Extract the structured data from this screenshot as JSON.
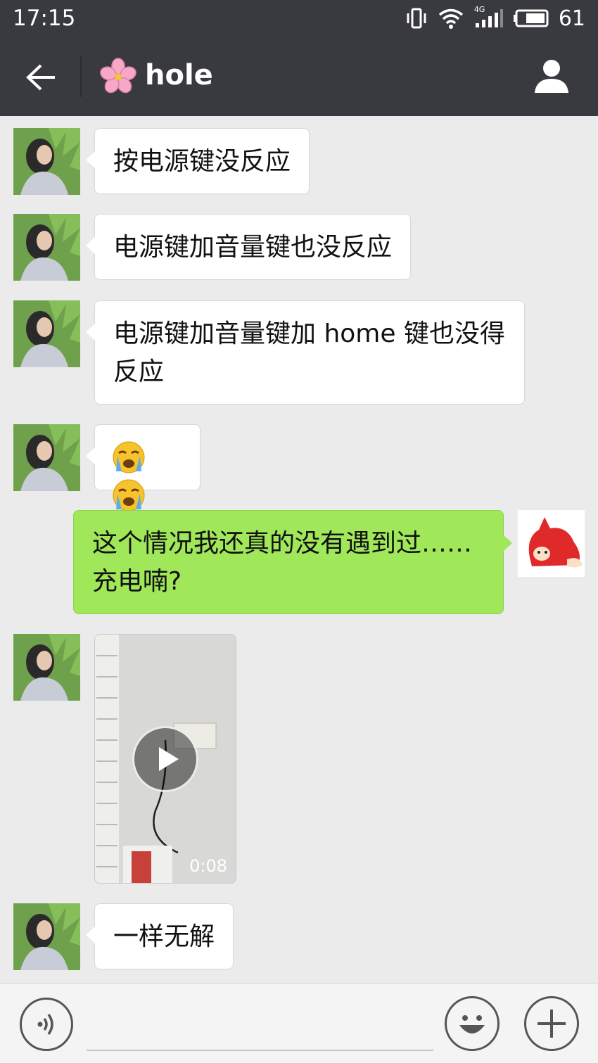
{
  "status_bar": {
    "time": "17:15",
    "network": "4G",
    "battery": "61",
    "icons": [
      "vibrate-icon",
      "wifi-icon",
      "signal-icon",
      "battery-icon"
    ]
  },
  "header": {
    "title": "hole",
    "back_icon": "arrow-left-icon",
    "title_icon": "cherry-blossom-icon",
    "profile_icon": "person-icon"
  },
  "messages": [
    {
      "sender": "contact",
      "type": "text",
      "lines": [
        "按电源键没反应"
      ]
    },
    {
      "sender": "contact",
      "type": "text",
      "lines": [
        "电源键加音量键也没反应"
      ]
    },
    {
      "sender": "contact",
      "type": "text",
      "lines": [
        "电源键加音量键加 home 键也没得",
        "反应"
      ]
    },
    {
      "sender": "contact",
      "type": "emoji",
      "emojis": [
        "loudly-crying-face-icon",
        "loudly-crying-face-icon"
      ]
    },
    {
      "sender": "me",
      "type": "text",
      "lines": [
        "这个情况我还真的没有遇到过……",
        "充电喃?"
      ]
    },
    {
      "sender": "contact",
      "type": "video",
      "duration": "0:08"
    },
    {
      "sender": "contact",
      "type": "text",
      "lines": [
        "一样无解"
      ]
    }
  ],
  "input_bar": {
    "voice_icon": "voice-icon",
    "emoji_icon": "smiley-icon",
    "plus_icon": "plus-icon",
    "input_value": ""
  },
  "colors": {
    "header_bg": "#393a3f",
    "chat_bg": "#ebebeb",
    "outgoing_bubble": "#a0e75a",
    "incoming_bubble": "#ffffff"
  }
}
